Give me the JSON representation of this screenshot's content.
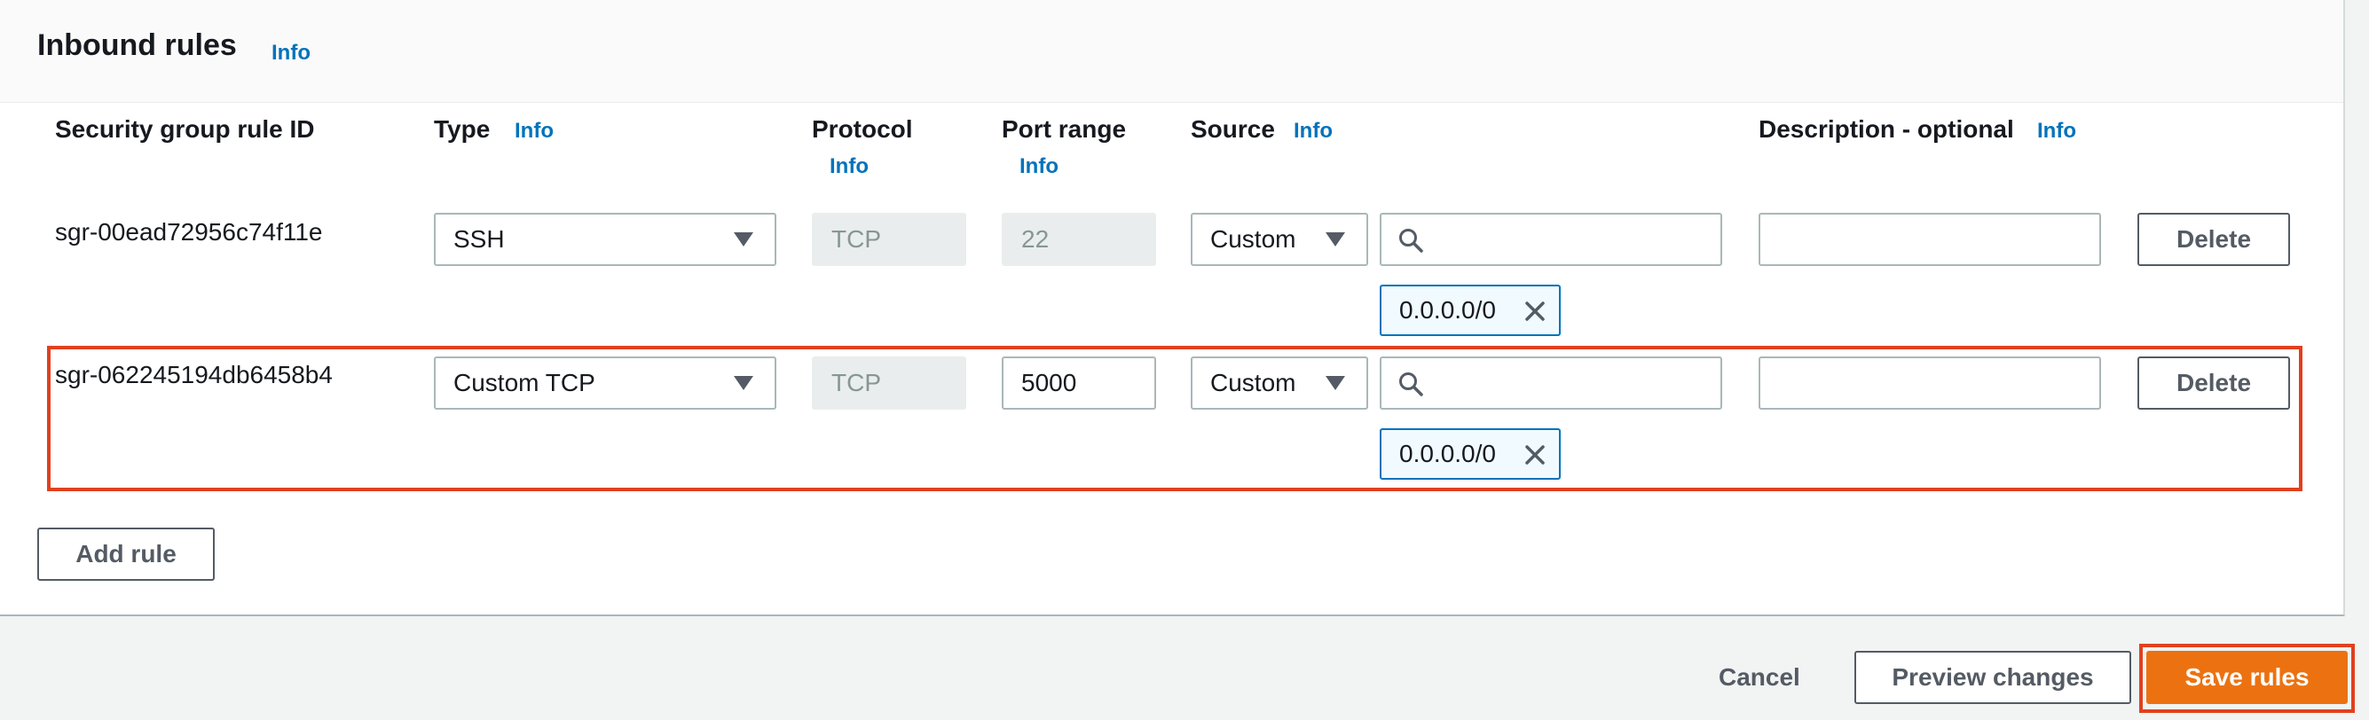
{
  "panel": {
    "title": "Inbound rules",
    "info_label": "Info"
  },
  "columns": {
    "rule_id": "Security group rule ID",
    "type": "Type",
    "protocol": "Protocol",
    "port_range": "Port range",
    "source": "Source",
    "description": "Description - optional",
    "info": "Info"
  },
  "rules": [
    {
      "rule_id": "sgr-00ead72956c74f11e",
      "type": "SSH",
      "protocol": "TCP",
      "port_range": "22",
      "source_type": "Custom",
      "source_search": "",
      "cidr": "0.0.0.0/0",
      "description": "",
      "delete_label": "Delete"
    },
    {
      "rule_id": "sgr-062245194db6458b4",
      "type": "Custom TCP",
      "protocol": "TCP",
      "port_range": "5000",
      "source_type": "Custom",
      "source_search": "",
      "cidr": "0.0.0.0/0",
      "description": "",
      "delete_label": "Delete"
    }
  ],
  "actions": {
    "add_rule": "Add rule",
    "cancel": "Cancel",
    "preview": "Preview changes",
    "save": "Save rules"
  },
  "colors": {
    "info_link": "#0073bb",
    "primary": "#ec7211",
    "highlight": "#e0411f"
  }
}
